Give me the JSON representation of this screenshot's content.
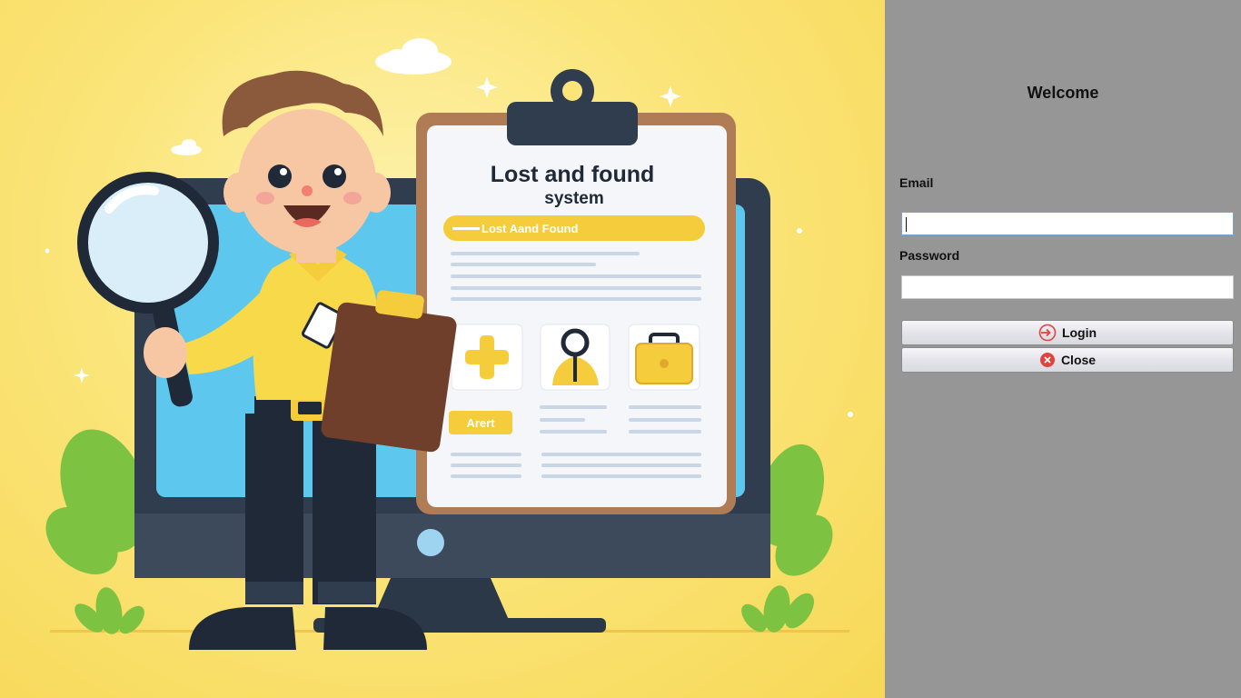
{
  "hero": {
    "board_title_line1": "Lost and found",
    "board_title_line2": "system",
    "board_banner": "Lost Aand Found",
    "board_alert": "Arert"
  },
  "login": {
    "welcome": "Welcome",
    "email_label": "Email",
    "email_value": "",
    "password_label": "Password",
    "password_value": "",
    "login_button": "Login",
    "close_button": "Close"
  },
  "colors": {
    "panel_bg": "#969696",
    "hero_bg": "#fbe57a",
    "login_icon": "#e0443e",
    "close_icon": "#e0443e"
  },
  "icons": {
    "login": "login-arrow-icon",
    "close": "close-circle-icon"
  }
}
